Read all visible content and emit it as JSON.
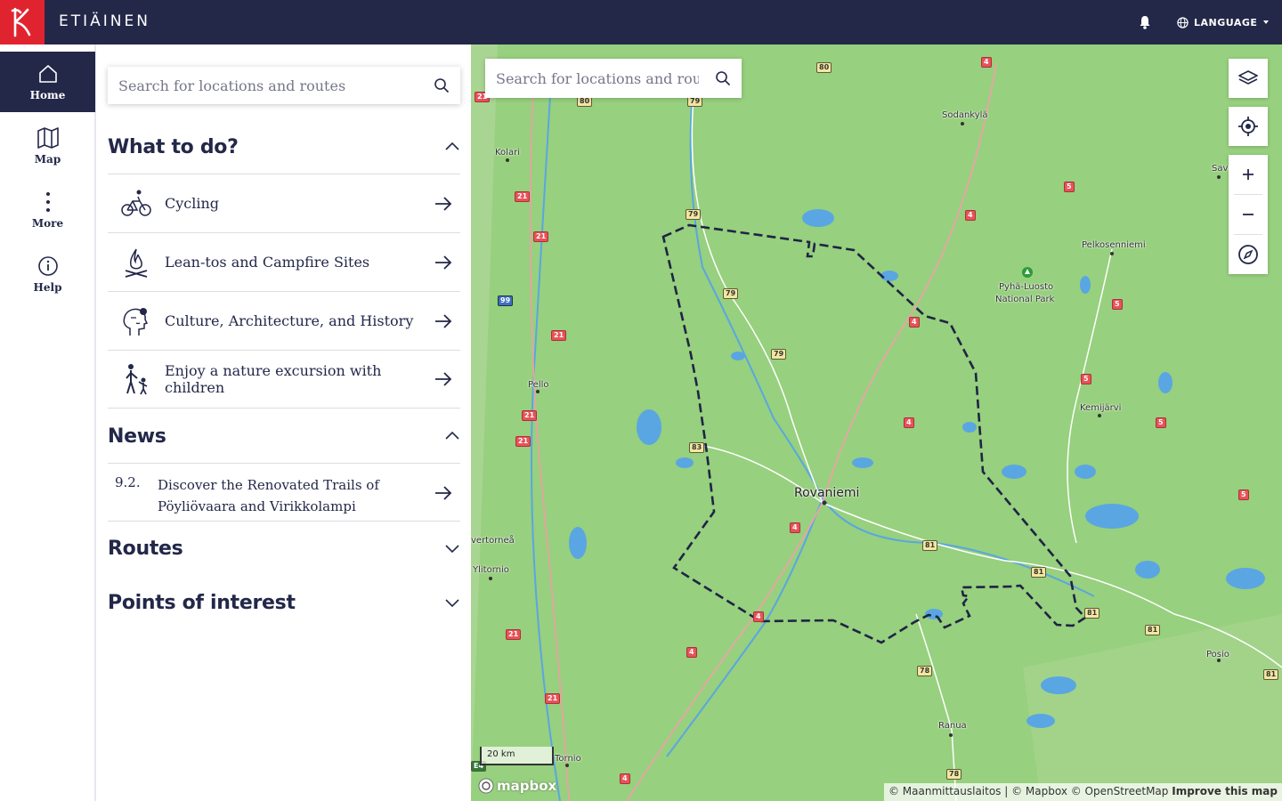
{
  "header": {
    "brand": "ETIÄINEN",
    "language_label": "LANGUAGE",
    "logo_icon": "metsahallitus-k-logo",
    "brand_color": "#232849",
    "logo_color": "#e0242f"
  },
  "rail": {
    "items": [
      {
        "label": "Home",
        "icon": "home-icon",
        "active": true
      },
      {
        "label": "Map",
        "icon": "map-icon",
        "active": false
      },
      {
        "label": "More",
        "icon": "more-icon",
        "active": false
      },
      {
        "label": "Help",
        "icon": "info-icon",
        "active": false
      }
    ]
  },
  "panel": {
    "search_placeholder": "Search for locations and routes",
    "what_to_do": {
      "title": "What to do?",
      "expanded": true,
      "items": [
        {
          "label": "Cycling",
          "icon": "bicycle-icon"
        },
        {
          "label": "Lean-tos and Campfire Sites",
          "icon": "campfire-icon"
        },
        {
          "label": "Culture, Architecture, and History",
          "icon": "culture-head-icon"
        },
        {
          "label": "Enjoy a nature excursion with children",
          "icon": "family-hike-icon"
        }
      ]
    },
    "news": {
      "title": "News",
      "expanded": true,
      "items": [
        {
          "date": "9.2.",
          "title": "Discover the Renovated Trails of Pöyliövaara and Virikkolampi"
        }
      ]
    },
    "routes": {
      "title": "Routes",
      "expanded": false
    },
    "poi": {
      "title": "Points of interest",
      "expanded": false
    }
  },
  "map": {
    "search_placeholder": "Search for locations and routes",
    "scale_label": "20 km",
    "provider": "mapbox",
    "attribution": "© Maanmittauslaitos | © Mapbox © OpenStreetMap",
    "improve_link": "Improve this map",
    "places": {
      "rovaniemi": "Rovaniemi",
      "sodankyla": "Sodankylä",
      "kolari": "Kolari",
      "pello": "Pello",
      "kemijarvi": "Kemijärvi",
      "pelkosenniemi": "Pelkosenniemi",
      "pyha1": "Pyhä-Luosto",
      "pyha2": "National Park",
      "savukoski": "Savuko",
      "ylitornio": "Ylitornio",
      "tornio": "Tornio",
      "ranua": "Ranua",
      "posio": "Posio",
      "vertornea": "vertorneå"
    },
    "road_numbers": {
      "r4": "4",
      "r5": "5",
      "r21": "21",
      "r78": "78",
      "r79": "79",
      "r80": "80",
      "r81": "81",
      "r83": "83",
      "r99": "99",
      "e4": "E4"
    },
    "controls": [
      "layers-icon",
      "locate-icon",
      "zoom-in-icon",
      "zoom-out-icon",
      "compass-icon"
    ]
  }
}
